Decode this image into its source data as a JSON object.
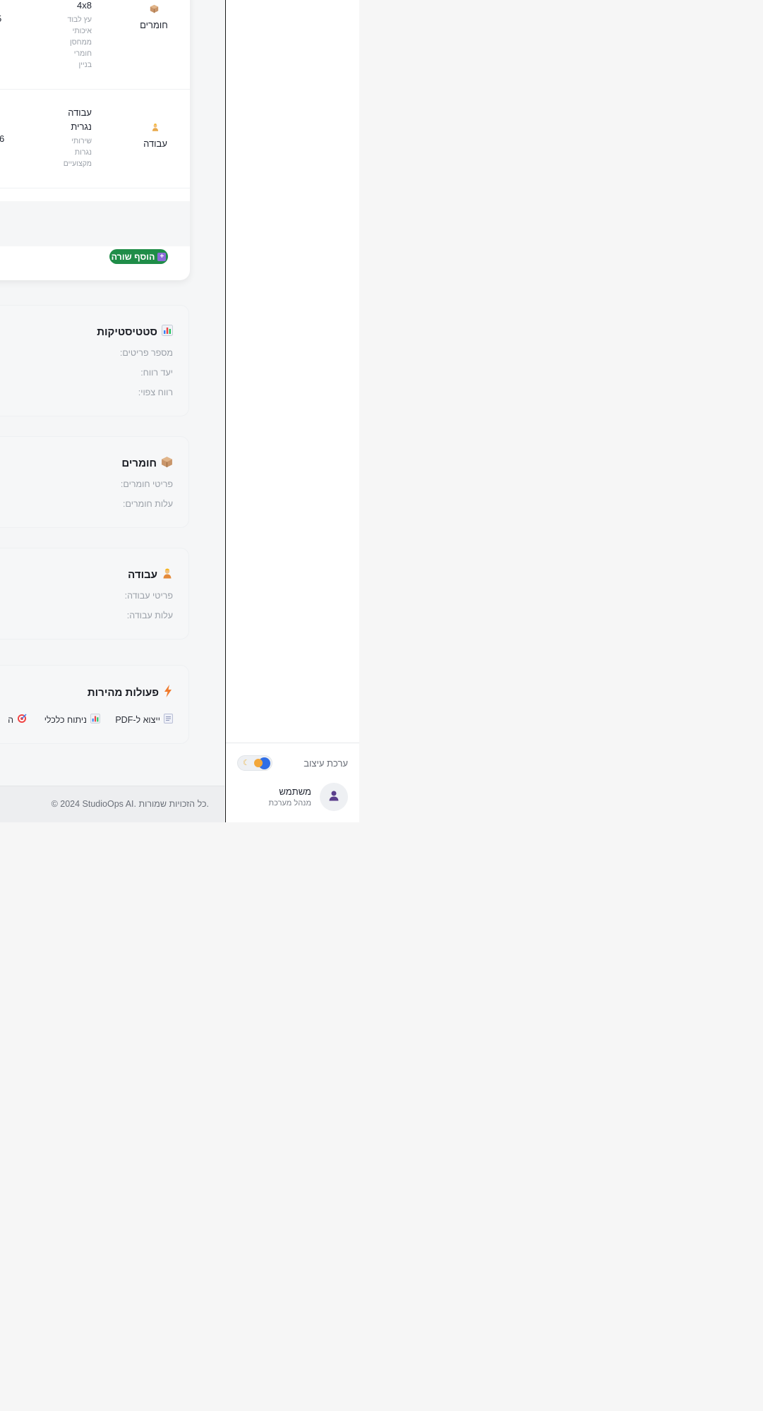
{
  "sidebar": {
    "theme_label": "ערכת עיצוב",
    "user_name": "משתמש",
    "user_role": "מנהל מערכת"
  },
  "table": {
    "rows": [
      {
        "category": "חומרים",
        "category_icon": "box-icon",
        "item_name": "4x8",
        "item_desc_lines": [
          "עץ לבוד",
          "איכותי",
          "ממחסן",
          "חומרי",
          "בניין"
        ],
        "cut_value": "5"
      },
      {
        "category": "עבודה",
        "category_icon": "worker-icon",
        "item_name_lines": [
          "עבודה",
          "נגרית"
        ],
        "item_desc_lines": [
          "שירותי",
          "נגרות",
          "מקצועיים"
        ],
        "cut_value": "6"
      }
    ],
    "add_row_label": "הוסף שורה"
  },
  "stats_panel": {
    "title": "סטטיסטיקות",
    "lines": [
      "מספר פריטים:",
      "יעד רווח:",
      "רווח צפוי:"
    ]
  },
  "materials_panel": {
    "title": "חומרים",
    "lines": [
      "פריטי חומרים:",
      "עלות חומרים:"
    ]
  },
  "labor_panel": {
    "title": "עבודה",
    "lines": [
      "פריטי עבודה:",
      "עלות עבודה:"
    ]
  },
  "quick_actions": {
    "title": "פעולות מהירות",
    "buttons": [
      {
        "label": "ייצוא ל-PDF",
        "icon": "document-icon"
      },
      {
        "label": "ניתוח כלכלי",
        "icon": "bar-chart-icon"
      },
      {
        "label": "ה",
        "icon": "target-icon"
      }
    ]
  },
  "footer": {
    "text": "© 2024 StudioOps AI. כל הזכויות שמורות."
  }
}
